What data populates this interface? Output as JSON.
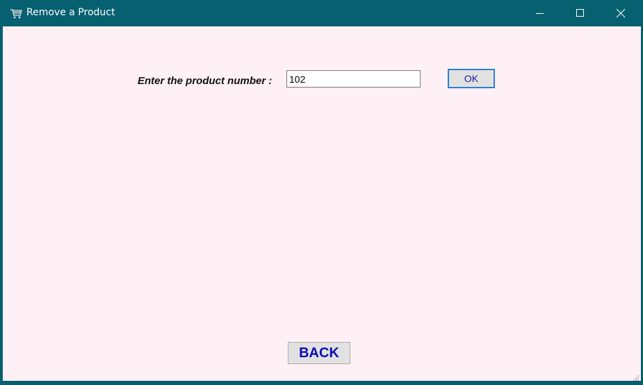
{
  "window": {
    "title": "Remove a Product",
    "app_icon": "cart-icon",
    "controls": {
      "minimize_icon": "minimize-icon",
      "maximize_icon": "maximize-icon",
      "close_icon": "close-icon"
    },
    "colors": {
      "titlebar": "#07606f",
      "client_background": "#fff0f5"
    }
  },
  "form": {
    "prompt_label": "Enter the product number :",
    "product_number_value": "102",
    "ok_label": "OK",
    "back_label": "BACK"
  }
}
